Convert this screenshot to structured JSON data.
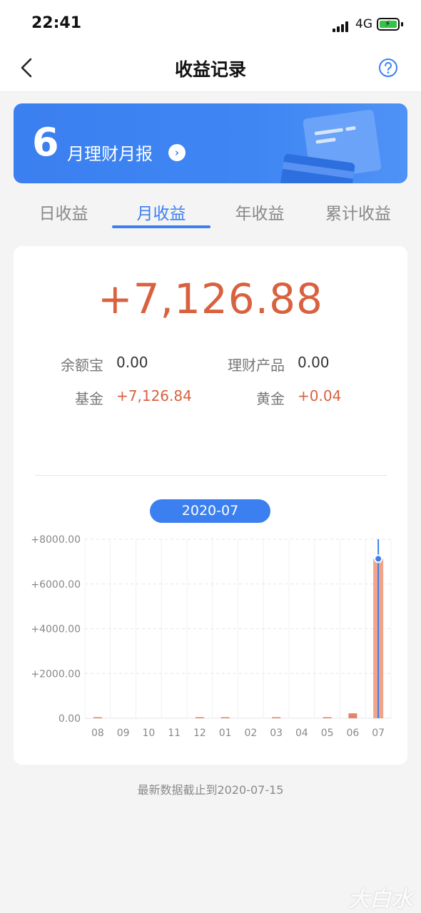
{
  "status_bar": {
    "time": "22:41",
    "network": "4G"
  },
  "nav": {
    "title": "收益记录"
  },
  "banner": {
    "month_number": "6",
    "text": "月理财月报"
  },
  "tabs": [
    {
      "label": "日收益",
      "active": false
    },
    {
      "label": "月收益",
      "active": true
    },
    {
      "label": "年收益",
      "active": false
    },
    {
      "label": "累计收益",
      "active": false
    }
  ],
  "summary": {
    "total": "+7,126.88",
    "items": [
      {
        "label": "余额宝",
        "value": "0.00"
      },
      {
        "label": "理财产品",
        "value": "0.00"
      },
      {
        "label": "基金",
        "value": "+7,126.84"
      },
      {
        "label": "黄金",
        "value": "+0.04"
      }
    ]
  },
  "selected_month": "2020-07",
  "chart_data": {
    "type": "bar",
    "categories": [
      "08",
      "09",
      "10",
      "11",
      "12",
      "01",
      "02",
      "03",
      "04",
      "05",
      "06",
      "07"
    ],
    "values": [
      0.5,
      0,
      0,
      0,
      0.5,
      0.5,
      0,
      0.3,
      0,
      0.4,
      220,
      7126.88
    ],
    "y_tick_labels": [
      "+8000.00",
      "+6000.00",
      "+4000.00",
      "+2000.00",
      "0.00"
    ],
    "ylim": [
      0,
      8000
    ],
    "highlighted_category": "07",
    "bar_color": "#e8826a",
    "highlight_color": "#f0a489",
    "marker_color": "#3b7ff0",
    "grid": true
  },
  "footer": {
    "note": "最新数据截止到2020-07-15"
  },
  "watermark": "大白水",
  "colors": {
    "accent": "#3b7ff0",
    "profit": "#d8613f"
  }
}
